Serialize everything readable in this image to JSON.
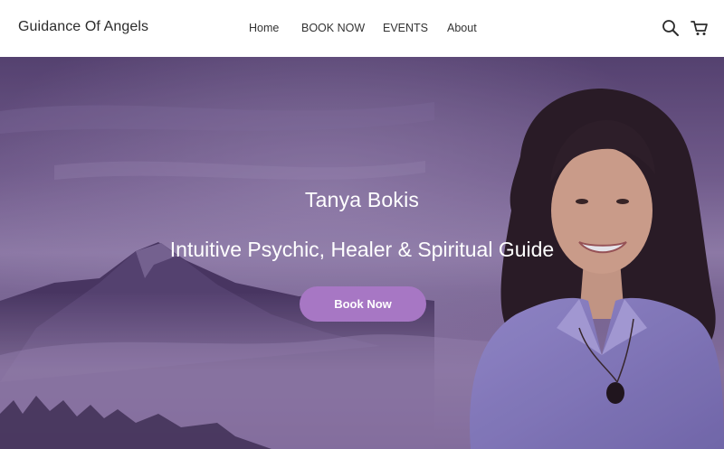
{
  "header": {
    "brand": "Guidance Of Angels",
    "nav": [
      {
        "label": "Home"
      },
      {
        "label": "BOOK NOW"
      },
      {
        "label": "EVENTS"
      },
      {
        "label": "About"
      }
    ],
    "icons": [
      "search-icon",
      "cart-icon"
    ]
  },
  "hero": {
    "title": "Tanya Bokis",
    "subtitle": "Intuitive Psychic, Healer & Spiritual Guide",
    "button_label": "Book Now"
  },
  "colors": {
    "accent": "#a777c4",
    "hero_base": "#735d8d",
    "header_bg": "#ffffff",
    "text_dark": "#2b2b2b"
  }
}
